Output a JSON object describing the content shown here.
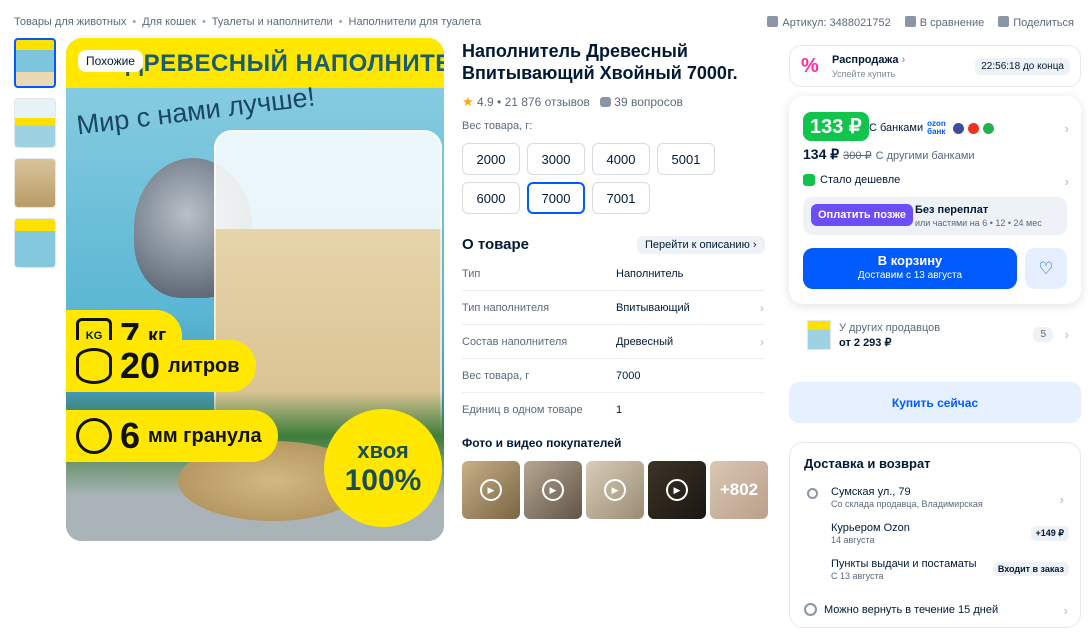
{
  "breadcrumbs": [
    "Товары для животных",
    "Для кошек",
    "Туалеты и наполнители",
    "Наполнители для туалета"
  ],
  "topbar": {
    "article": "Артикул: 3488021752",
    "compare": "В сравнение",
    "share": "Поделиться"
  },
  "gallery": {
    "similar_label": "Похожие",
    "banner": "ДРЕВЕСНЫЙ НАПОЛНИТЕЛЬ",
    "slogan": "Мир с нами лучше!",
    "feat1_num": "7",
    "feat1_unit": "кг",
    "feat1_icon_text": "KG",
    "feat2_num": "20",
    "feat2_unit": "литров",
    "feat3_num": "6",
    "feat3_unit": "мм гранула",
    "badge_line1": "хвоя",
    "badge_line2": "100%"
  },
  "product": {
    "title": "Наполнитель Древесный Впитывающий Хвойный 7000г.",
    "rating": "4.9",
    "reviews": "21 876 отзывов",
    "questions": "39 вопросов",
    "weight_label": "Вес товара, г:",
    "weights": [
      "2000",
      "3000",
      "4000",
      "5001",
      "6000",
      "7000",
      "7001"
    ],
    "selected_weight": "7000"
  },
  "about": {
    "title": "О товаре",
    "goto": "Перейти к описанию",
    "specs": [
      {
        "k": "Тип",
        "v": "Наполнитель"
      },
      {
        "k": "Тип наполнителя",
        "v": "Впитывающий"
      },
      {
        "k": "Состав наполнителя",
        "v": "Древесный"
      },
      {
        "k": "Вес товара, г",
        "v": "7000"
      },
      {
        "k": "Единиц в одном товаре",
        "v": "1"
      }
    ],
    "photos_title": "Фото и видео покупателей",
    "photos_more": "+802"
  },
  "sale": {
    "title": "Распродажа",
    "subtitle": "Успейте купить",
    "timer": "22:56:18 до конца"
  },
  "price": {
    "bank_price": "133 ₽",
    "bank_label": "С банками",
    "ozon_bank": "ozon банк",
    "price": "134 ₽",
    "old_price": "300 ₽",
    "other_banks": "С другими банками",
    "cheaper": "Стало дешевле",
    "pay_later_btn": "Оплатить позже",
    "pay_later_title": "Без переплат",
    "pay_later_sub": "или частями на 6 • 12 • 24 мес",
    "cart": "В корзину",
    "cart_sub": "Доставим с 13 августа"
  },
  "sellers": {
    "title": "У других продавцов",
    "price": "от 2 293 ₽",
    "count": "5"
  },
  "buy_now": "Купить сейчас",
  "delivery": {
    "title": "Доставка и возврат",
    "address": "Сумская ул., 79",
    "address_sub": "Со склада продавца, Владимирская",
    "courier": "Курьером Ozon",
    "courier_date": "14 августа",
    "courier_price": "+149 ₽",
    "pickup": "Пункты выдачи и постаматы",
    "pickup_date": "С 13 августа",
    "pickup_tag": "Входит в заказ",
    "return": "Можно вернуть в течение 15 дней"
  },
  "colors": {
    "accent": "#005bff",
    "green": "#10c44c",
    "yellow": "#ffe700",
    "purple": "#6b4ef6"
  }
}
